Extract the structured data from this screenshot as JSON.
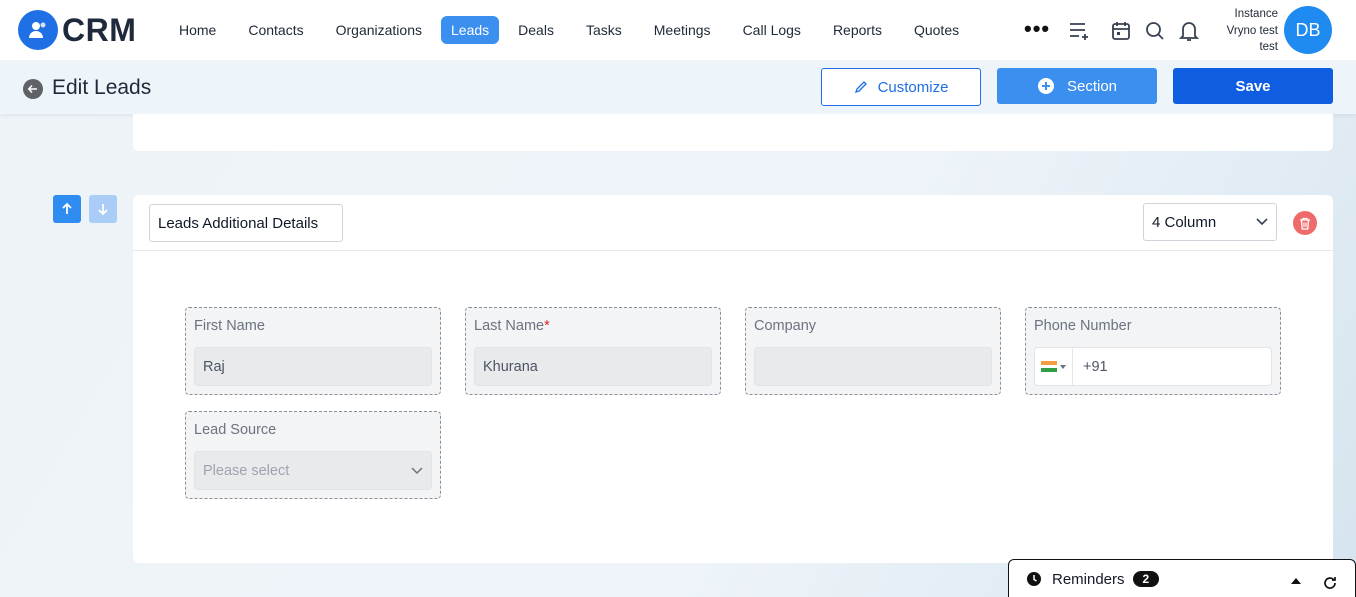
{
  "app": {
    "logo_text": "CRM"
  },
  "nav": {
    "items": [
      {
        "label": "Home"
      },
      {
        "label": "Contacts"
      },
      {
        "label": "Organizations"
      },
      {
        "label": "Leads"
      },
      {
        "label": "Deals"
      },
      {
        "label": "Tasks"
      },
      {
        "label": "Meetings"
      },
      {
        "label": "Call Logs"
      },
      {
        "label": "Reports"
      },
      {
        "label": "Quotes"
      }
    ],
    "active": "Leads",
    "more_label": "•••"
  },
  "user": {
    "instance_line1": "Instance",
    "instance_line2": "Vryno test",
    "instance_line3": "test",
    "initials": "DB"
  },
  "header": {
    "title": "Edit Leads",
    "customize_label": "Customize",
    "section_label": "Section",
    "save_label": "Save"
  },
  "section": {
    "name": "Leads Additional Details",
    "columns": "4 Column",
    "fields": [
      {
        "label": "First Name",
        "required": false,
        "value": "Raj"
      },
      {
        "label": "Last Name",
        "required": true,
        "value": "Khurana"
      },
      {
        "label": "Company",
        "required": false,
        "value": ""
      },
      {
        "label": "Phone Number",
        "required": false,
        "value": "+91"
      },
      {
        "label": "Lead Source",
        "required": false,
        "placeholder": "Please select"
      }
    ]
  },
  "reminders": {
    "label": "Reminders",
    "count": "2"
  },
  "colors": {
    "accent": "#3b8fef",
    "primary": "#0f5de0",
    "danger": "#ef6b6b"
  }
}
